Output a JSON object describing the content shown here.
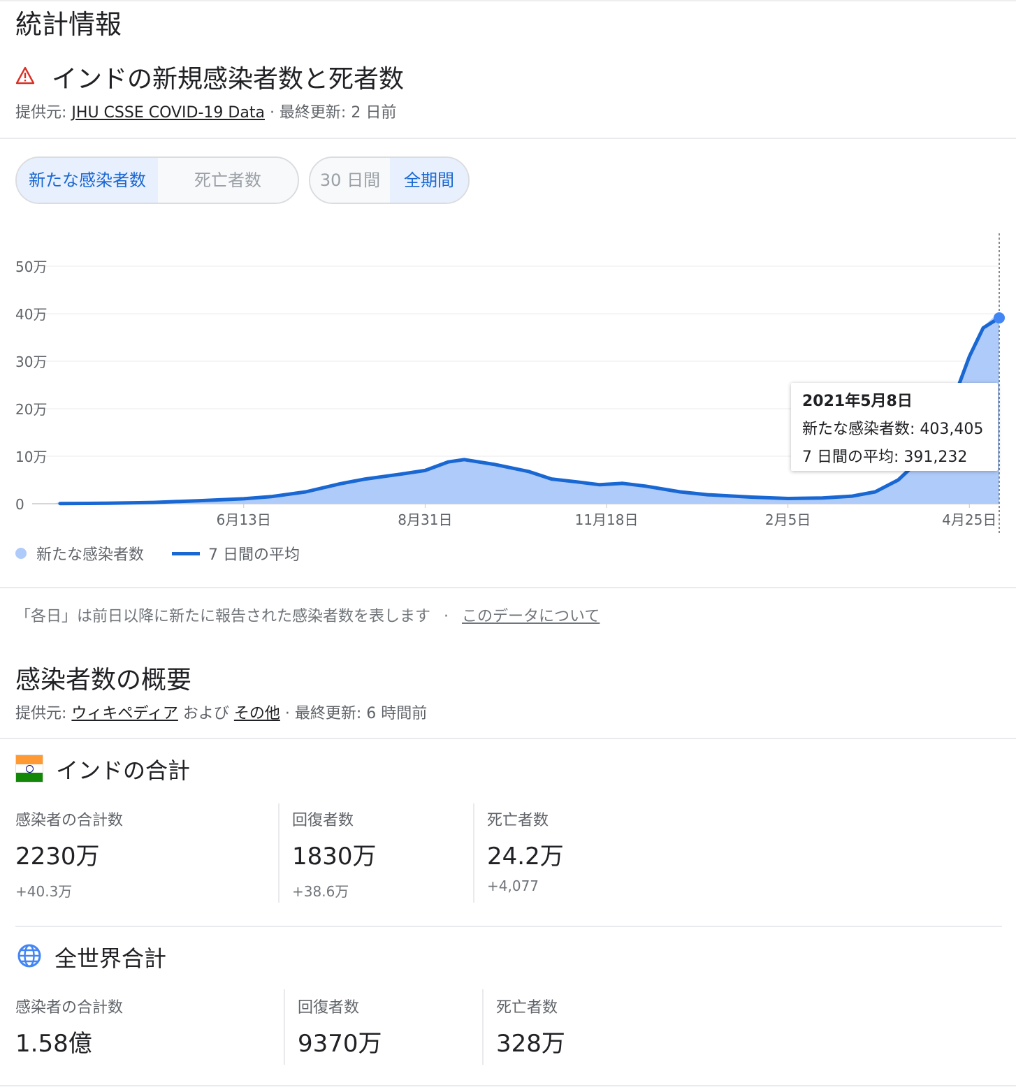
{
  "header": {
    "title": "統計情報"
  },
  "chart_section": {
    "title": "インドの新規感染者数と死者数",
    "source_prefix": "提供元: ",
    "source_link": "JHU CSSE COVID-19 Data",
    "updated": " · 最終更新: 2 日前",
    "metric_tabs": [
      "新たな感染者数",
      "死亡者数"
    ],
    "range_tabs": [
      "30 日間",
      "全期間"
    ],
    "tooltip": {
      "date": "2021年5月8日",
      "cases": "新たな感染者数: 403,405",
      "avg": "7 日間の平均: 391,232"
    },
    "legend": {
      "bars": "新たな感染者数",
      "line": "7 日間の平均"
    },
    "footnote": "「各日」は前日以降に新たに報告された感染者数を表します",
    "footnote_sep": "·",
    "footnote_link": "このデータについて"
  },
  "colors": {
    "accent": "#1a73e8",
    "bars": "#aecbfa",
    "line": "#1967d2",
    "warning": "#d93025"
  },
  "chart_data": {
    "type": "area",
    "title": "インドの新規感染者数と死者数",
    "y_ticks": [
      "0",
      "10万",
      "20万",
      "30万",
      "40万",
      "50万"
    ],
    "ylim": [
      0,
      500000
    ],
    "x_ticks": [
      "6月13日",
      "8月31日",
      "11月18日",
      "2月5日",
      "4月25日"
    ],
    "grid": true,
    "series": [
      {
        "name": "7 日間の平均",
        "points": [
          [
            "2020-03-25",
            500
          ],
          [
            "2020-04-15",
            1000
          ],
          [
            "2020-05-05",
            2800
          ],
          [
            "2020-05-25",
            6500
          ],
          [
            "2020-06-13",
            10500
          ],
          [
            "2020-06-25",
            15000
          ],
          [
            "2020-07-10",
            25000
          ],
          [
            "2020-07-25",
            42000
          ],
          [
            "2020-08-05",
            52000
          ],
          [
            "2020-08-20",
            62000
          ],
          [
            "2020-08-31",
            70000
          ],
          [
            "2020-09-10",
            88000
          ],
          [
            "2020-09-17",
            93000
          ],
          [
            "2020-09-30",
            83000
          ],
          [
            "2020-10-15",
            68000
          ],
          [
            "2020-10-25",
            52000
          ],
          [
            "2020-11-05",
            46000
          ],
          [
            "2020-11-15",
            40000
          ],
          [
            "2020-11-25",
            43000
          ],
          [
            "2020-12-05",
            37000
          ],
          [
            "2020-12-20",
            25000
          ],
          [
            "2021-01-01",
            19000
          ],
          [
            "2021-01-20",
            14000
          ],
          [
            "2021-02-05",
            11000
          ],
          [
            "2021-02-20",
            12000
          ],
          [
            "2021-03-05",
            16000
          ],
          [
            "2021-03-15",
            25000
          ],
          [
            "2021-03-25",
            50000
          ],
          [
            "2021-04-05",
            100000
          ],
          [
            "2021-04-15",
            180000
          ],
          [
            "2021-04-25",
            310000
          ],
          [
            "2021-05-01",
            370000
          ],
          [
            "2021-05-08",
            391232
          ]
        ]
      },
      {
        "name": "新たな感染者数",
        "highlight": [
          "2021-05-08",
          403405
        ]
      }
    ]
  },
  "overview": {
    "title": "感染者数の概要",
    "source_prefix": "提供元: ",
    "link1": "ウィキペディア",
    "mid": " および ",
    "link2": "その他",
    "updated": " · 最終更新: 6 時間前"
  },
  "india": {
    "title": "インドの合計",
    "stats": [
      {
        "label": "感染者の合計数",
        "value": "2230万",
        "delta": "+40.3万"
      },
      {
        "label": "回復者数",
        "value": "1830万",
        "delta": "+38.6万"
      },
      {
        "label": "死亡者数",
        "value": "24.2万",
        "delta": "+4,077"
      }
    ]
  },
  "world": {
    "title": "全世界合計",
    "stats": [
      {
        "label": "感染者の合計数",
        "value": "1.58億"
      },
      {
        "label": "回復者数",
        "value": "9370万"
      },
      {
        "label": "死亡者数",
        "value": "328万"
      }
    ]
  }
}
